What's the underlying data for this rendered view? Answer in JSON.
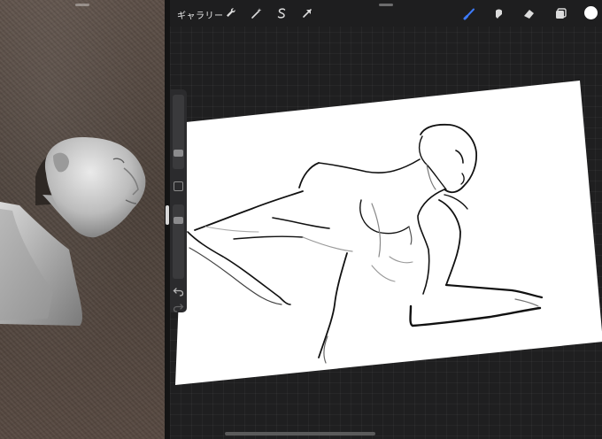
{
  "toolbar": {
    "gallery_label": "ギャラリー",
    "actions_icon": "wrench-icon",
    "adjustments_icon": "magic-wand-icon",
    "selection_icon": "selection-s-icon",
    "transform_icon": "arrow-cursor-icon",
    "brush_icon": "brush-icon",
    "smudge_icon": "smudge-icon",
    "eraser_icon": "eraser-icon",
    "layers_icon": "layers-icon",
    "color_hex": "#ffffff",
    "accent_hex": "#3d7bff"
  },
  "sidebar": {
    "brush_size_level": 0.26,
    "opacity_level": 0.18,
    "undo_icon": "undo-icon",
    "redo_icon": "redo-icon"
  },
  "split_view": {
    "reference_subject": "3d-head-bust"
  }
}
